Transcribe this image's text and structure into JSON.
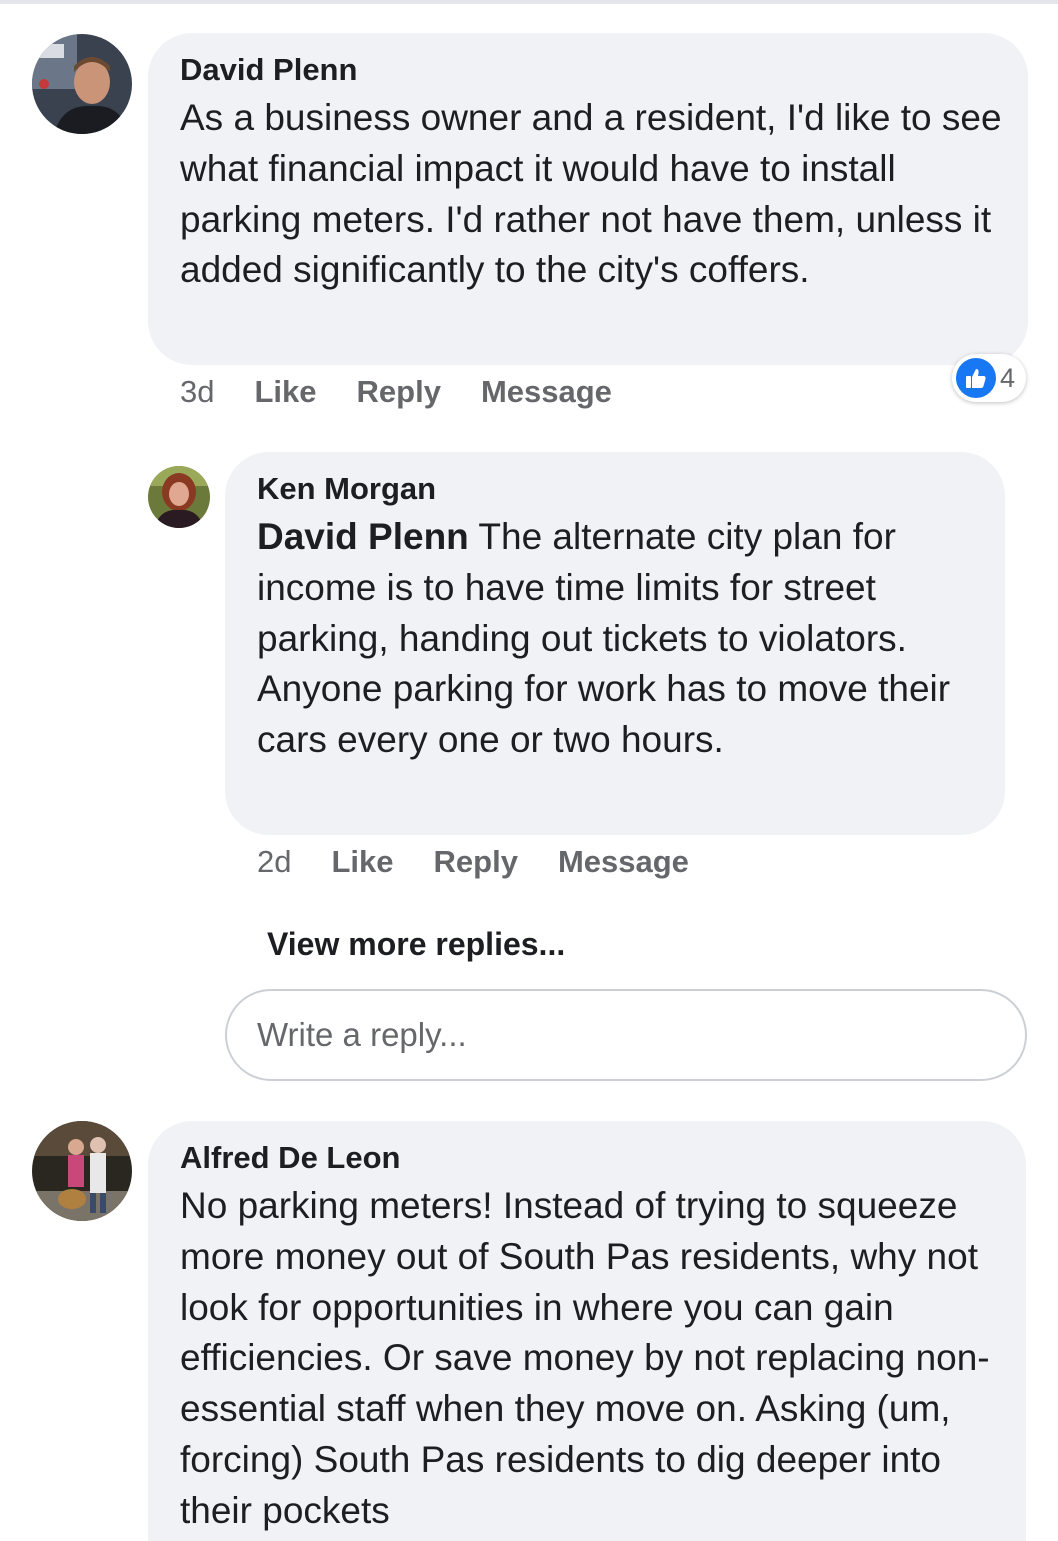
{
  "comments": [
    {
      "author": "David Plenn",
      "text": "As a business owner and a resident, I'd like to see what financial impact it would have to install parking meters.  I'd rather not have them, unless it added significantly to the city's coffers.",
      "time": "3d",
      "like_label": "Like",
      "reply_label": "Reply",
      "message_label": "Message",
      "reaction_count": "4"
    },
    {
      "author": "Ken Morgan",
      "mention": "David Plenn",
      "text": " The alternate city plan for income is to have time limits for street parking, handing out tickets to violators.  Anyone parking for work has to move their cars every one or two hours.",
      "time": "2d",
      "like_label": "Like",
      "reply_label": "Reply",
      "message_label": "Message"
    },
    {
      "author": "Alfred De Leon",
      "text": "No parking meters! Instead of trying to squeeze more money out of South Pas residents, why not look for opportunities in where you can gain efficiencies. Or save money by not replacing non-essential staff when they move on. Asking (um, forcing) South Pas residents to dig deeper into their pockets"
    }
  ],
  "view_more_replies": "View more replies...",
  "reply_placeholder": "Write a reply...",
  "colors": {
    "bubble": "#f0f2f5",
    "meta": "#65676b",
    "like_blue": "#1877f2"
  }
}
